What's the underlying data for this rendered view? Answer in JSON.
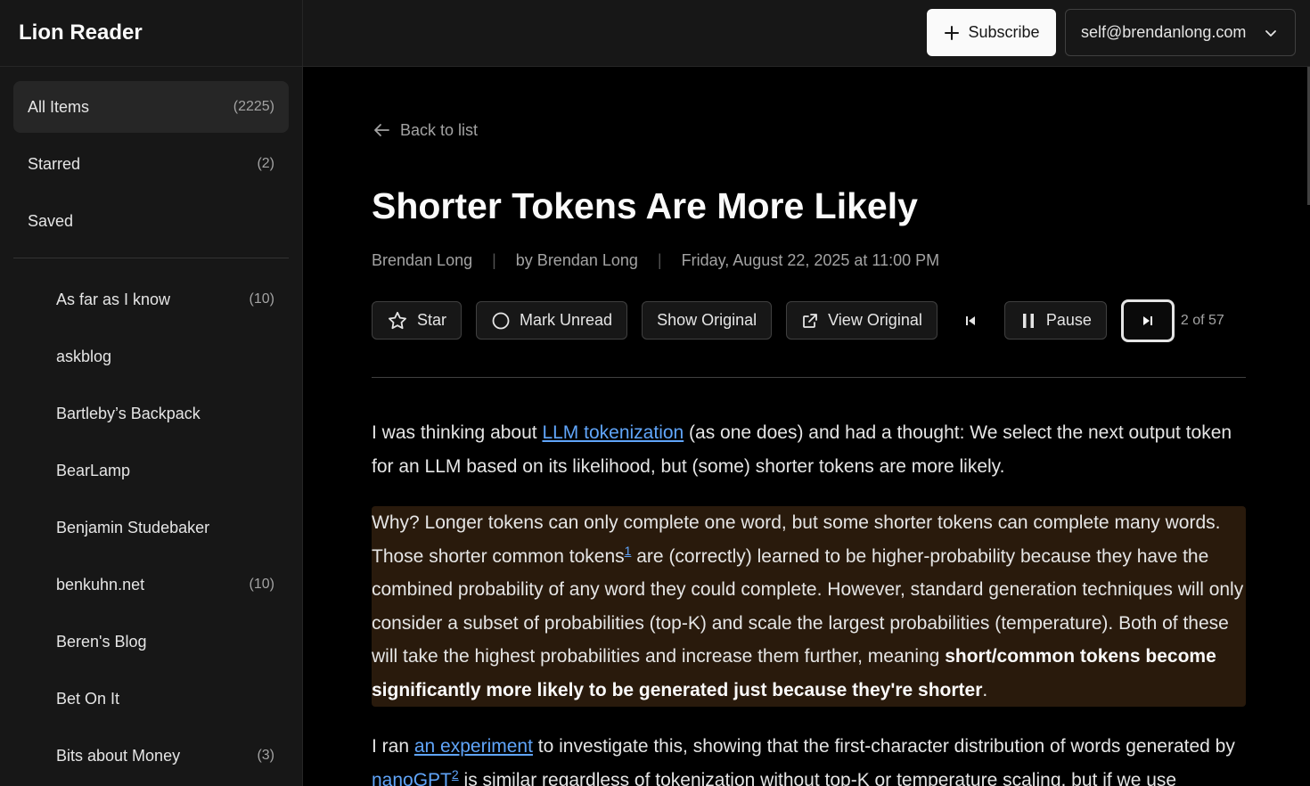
{
  "app": {
    "name": "Lion Reader"
  },
  "header": {
    "subscribe_label": "Subscribe",
    "user_email": "self@brendanlong.com"
  },
  "sidebar": {
    "nav": [
      {
        "label": "All Items",
        "count": "(2225)"
      },
      {
        "label": "Starred",
        "count": "(2)"
      },
      {
        "label": "Saved",
        "count": ""
      }
    ],
    "feeds": [
      {
        "label": "As far as I know",
        "count": "(10)"
      },
      {
        "label": "askblog",
        "count": ""
      },
      {
        "label": "Bartleby’s Backpack",
        "count": ""
      },
      {
        "label": "BearLamp",
        "count": ""
      },
      {
        "label": "Benjamin Studebaker",
        "count": ""
      },
      {
        "label": "benkuhn.net",
        "count": "(10)"
      },
      {
        "label": "Beren's Blog",
        "count": ""
      },
      {
        "label": "Bet On It",
        "count": ""
      },
      {
        "label": "Bits about Money",
        "count": "(3)"
      }
    ]
  },
  "article": {
    "back_label": "Back to list",
    "title": "Shorter Tokens Are More Likely",
    "feed": "Brendan Long",
    "author": "by Brendan Long",
    "date": "Friday, August 22, 2025 at 11:00 PM",
    "sep": "|",
    "actions": {
      "star": "Star",
      "mark_unread": "Mark Unread",
      "show_original": "Show Original",
      "view_original": "View Original",
      "pause": "Pause",
      "position": "2 of 57"
    },
    "p1": {
      "before": "I was thinking about ",
      "link": "LLM tokenization",
      "after": " (as one does) and had a thought: We select the next output token for an LLM based on its likelihood, but (some) shorter tokens are more likely."
    },
    "p2": {
      "before": "Why? Longer tokens can only complete one word, but some shorter tokens can complete many words. Those shorter common tokens",
      "footnote": "1",
      "middle": " are (correctly) learned to be higher-probability because they have the combined probability of any word they could complete. However, standard generation techniques will only consider a subset of probabilities (top-K) and scale the largest probabilities (temperature). Both of these will take the highest probabilities and increase them further, meaning ",
      "bold": "short/common tokens become significantly more likely to be generated just because they're shorter",
      "end": "."
    },
    "p3": {
      "before": "I ran ",
      "link1": "an experiment",
      "middle": " to investigate this, showing that the first-character distribution of words generated by ",
      "link2": "nanoGPT",
      "footnote": "2",
      "after": " is similar regardless of tokenization without top-K or temperature scaling, but if we use"
    }
  },
  "colors": {
    "highlight": "#291a0c",
    "link": "#60a5fa",
    "sidebar_bg": "#171717"
  }
}
